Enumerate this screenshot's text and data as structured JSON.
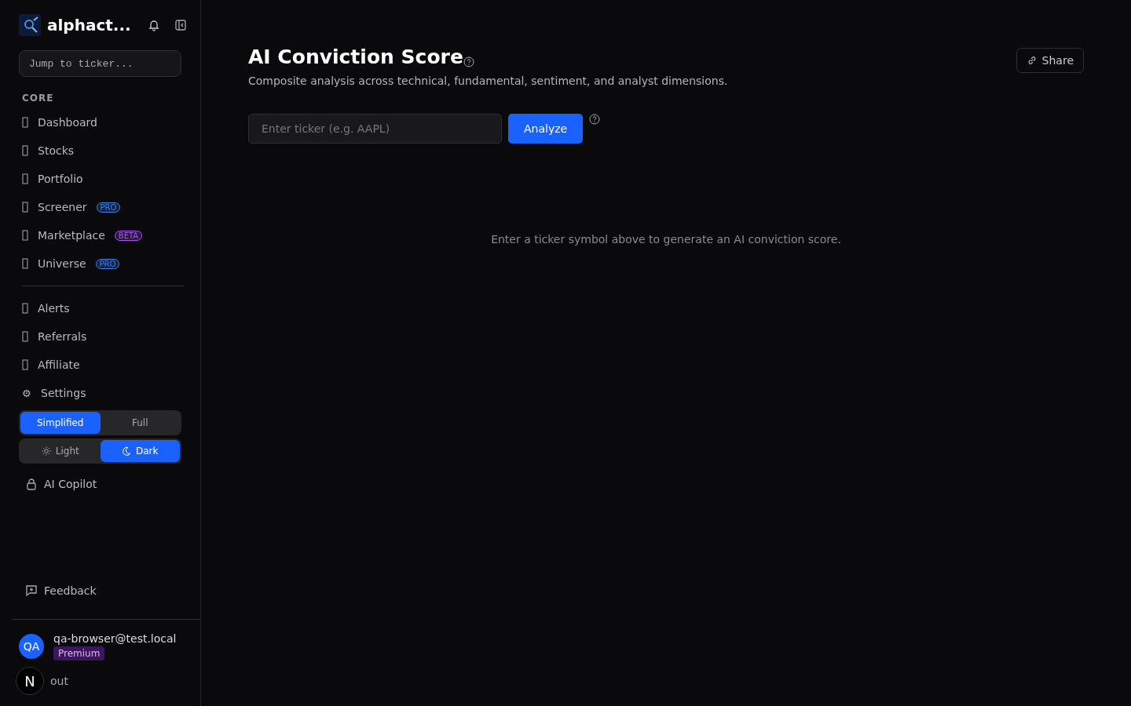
{
  "sidebar": {
    "brand": "alphact...",
    "search": {
      "placeholder": "Jump to ticker..."
    },
    "section_label": "CORE",
    "groups": [
      [
        {
          "label": "Dashboard",
          "kind": "missing"
        },
        {
          "label": "Stocks",
          "kind": "missing"
        },
        {
          "label": "Portfolio",
          "kind": "missing"
        },
        {
          "label": "Screener",
          "kind": "missing",
          "badge": "PRO",
          "color": "#3b82f6"
        },
        {
          "label": "Marketplace",
          "kind": "missing",
          "badge": "BETA",
          "color": "#a855f7"
        },
        {
          "label": "Universe",
          "kind": "missing",
          "badge": "PRO",
          "color": "#3b82f6"
        }
      ],
      [
        {
          "label": "Alerts",
          "kind": "missing"
        },
        {
          "label": "Referrals",
          "kind": "missing"
        },
        {
          "label": "Affiliate",
          "kind": "missing"
        },
        {
          "label": "Settings",
          "kind": "glyph",
          "icon": "⚙"
        }
      ]
    ],
    "view_mode": [
      {
        "label": "Simplified",
        "selected": true
      },
      {
        "label": "Full",
        "selected": false
      }
    ],
    "theme": [
      {
        "label": "Light",
        "kind": "sun",
        "selected": false
      },
      {
        "label": "Dark",
        "kind": "moon",
        "selected": true
      }
    ],
    "copilot": "AI Copilot",
    "feedback": "Feedback",
    "user": {
      "initials": "QA",
      "email": "qa-browser@test.local",
      "plan": "Premium"
    },
    "sign_out": "out",
    "dev_badge": "N"
  },
  "main": {
    "title": "AI Conviction Score",
    "subtitle": "Composite analysis across technical, fundamental, sentiment, and analyst dimensions.",
    "share": "Share",
    "ticker": {
      "placeholder": "Enter ticker (e.g. AAPL)"
    },
    "analyze": "Analyze",
    "empty": "Enter a ticker symbol above to generate an AI conviction score."
  }
}
